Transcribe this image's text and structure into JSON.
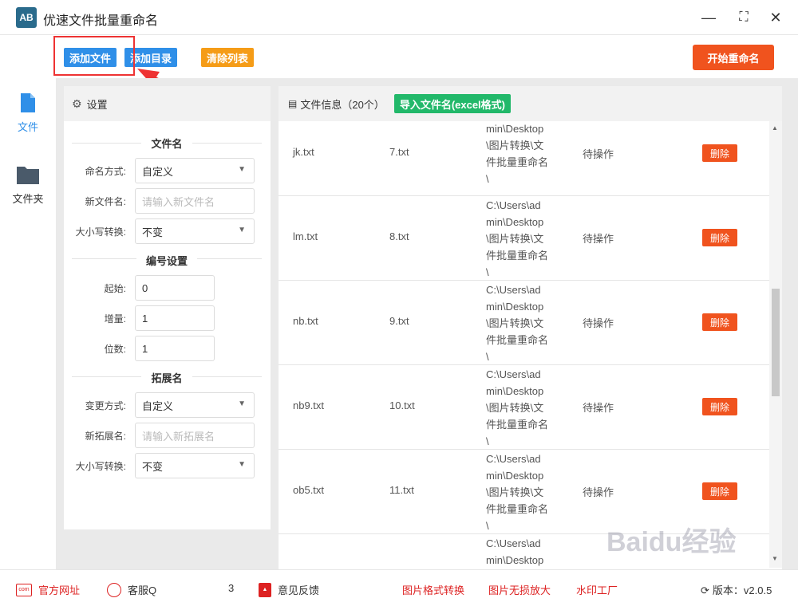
{
  "window": {
    "logo_text": "AB",
    "title": "优速文件批量重命名",
    "minimize": "—",
    "maximize": "⛶",
    "close": "✕"
  },
  "toolbar": {
    "add_file": "添加文件",
    "add_dir": "添加目录",
    "clear_list": "清除列表",
    "start_rename": "开始重命名"
  },
  "nav": {
    "file": "文件",
    "folder": "文件夹"
  },
  "settings": {
    "header": "设置",
    "section_filename": "文件名",
    "naming_mode_label": "命名方式:",
    "naming_mode_value": "自定义",
    "new_name_label": "新文件名:",
    "new_name_placeholder": "请输入新文件名",
    "case_label": "大小写转换:",
    "case_value": "不变",
    "section_numbering": "编号设置",
    "start_label": "起始:",
    "start_value": "0",
    "step_label": "增量:",
    "step_value": "1",
    "digits_label": "位数:",
    "digits_value": "1",
    "section_ext": "拓展名",
    "ext_mode_label": "变更方式:",
    "ext_mode_value": "自定义",
    "new_ext_label": "新拓展名:",
    "new_ext_placeholder": "请输入新拓展名",
    "ext_case_label": "大小写转换:",
    "ext_case_value": "不变"
  },
  "files": {
    "header": "文件信息（20个）",
    "import_button": "导入文件名(excel格式)",
    "rows": [
      {
        "name": "jk.txt",
        "new": "7.txt",
        "path": "min\\Desktop\n\\图片转换\\文\n件批量重命名\n\\",
        "status": "待操作",
        "action": "删除"
      },
      {
        "name": "lm.txt",
        "new": "8.txt",
        "path": "C:\\Users\\ad\nmin\\Desktop\n\\图片转换\\文\n件批量重命名\n\\",
        "status": "待操作",
        "action": "删除"
      },
      {
        "name": "nb.txt",
        "new": "9.txt",
        "path": "C:\\Users\\ad\nmin\\Desktop\n\\图片转换\\文\n件批量重命名\n\\",
        "status": "待操作",
        "action": "删除"
      },
      {
        "name": "nb9.txt",
        "new": "10.txt",
        "path": "C:\\Users\\ad\nmin\\Desktop\n\\图片转换\\文\n件批量重命名\n\\",
        "status": "待操作",
        "action": "删除"
      },
      {
        "name": "ob5.txt",
        "new": "11.txt",
        "path": "C:\\Users\\ad\nmin\\Desktop\n\\图片转换\\文\n件批量重命名\n\\",
        "status": "待操作",
        "action": "删除"
      },
      {
        "name": "",
        "new": "",
        "path": "C:\\Users\\ad\nmin\\Desktop",
        "status": "",
        "action": ""
      }
    ]
  },
  "bottom": {
    "website": "官方网址",
    "service": "客服Q",
    "service_tail": "3",
    "feedback": "意见反馈",
    "link1": "图片格式转换",
    "link2": "图片无损放大",
    "link3": "水印工厂",
    "version": "版本：v2.0.5"
  },
  "watermark": "Baidu经验"
}
